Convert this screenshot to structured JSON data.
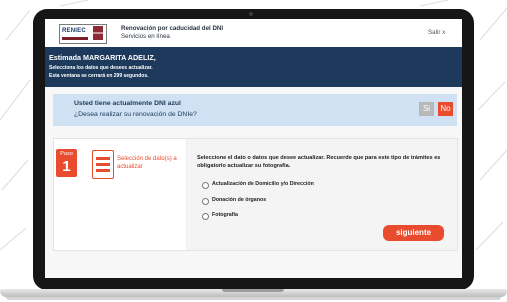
{
  "header": {
    "logo_text": "RENIEC",
    "title": "Renovación por caducidad del DNI",
    "subtitle": "Servicios en línea",
    "logout_label": "Salir x"
  },
  "banner": {
    "greeting": "Estimada MARGARITA ADELIZ,",
    "instruction": "Selecciona los datos que desees actualizar.",
    "timer": "Esta ventana se cerrará en 299 segundos."
  },
  "dni_prompt": {
    "status": "Usted tiene actualmente DNI azul",
    "question": "¿Desea realizar su renovación de DNIe?",
    "yes_label": "Si",
    "no_label": "No"
  },
  "step": {
    "step_word": "Paso",
    "step_number": "1",
    "step_title": "Selección de dato(s) a actualizar",
    "description": "Seleccione el dato o datos que desee actualizar. Recuerde que para este tipo de trámites es obligatorio actualizar su fotografía.",
    "options": [
      {
        "label": "Actualización de Domicilio y/o Dirección",
        "checked": false
      },
      {
        "label": "Donación de órganos",
        "checked": false
      },
      {
        "label": "Fotografía",
        "checked": false
      }
    ],
    "next_label": "siguiente"
  },
  "colors": {
    "accent": "#e84b2e",
    "banner": "#1d3a5c",
    "info_box": "#cfe1f3"
  }
}
